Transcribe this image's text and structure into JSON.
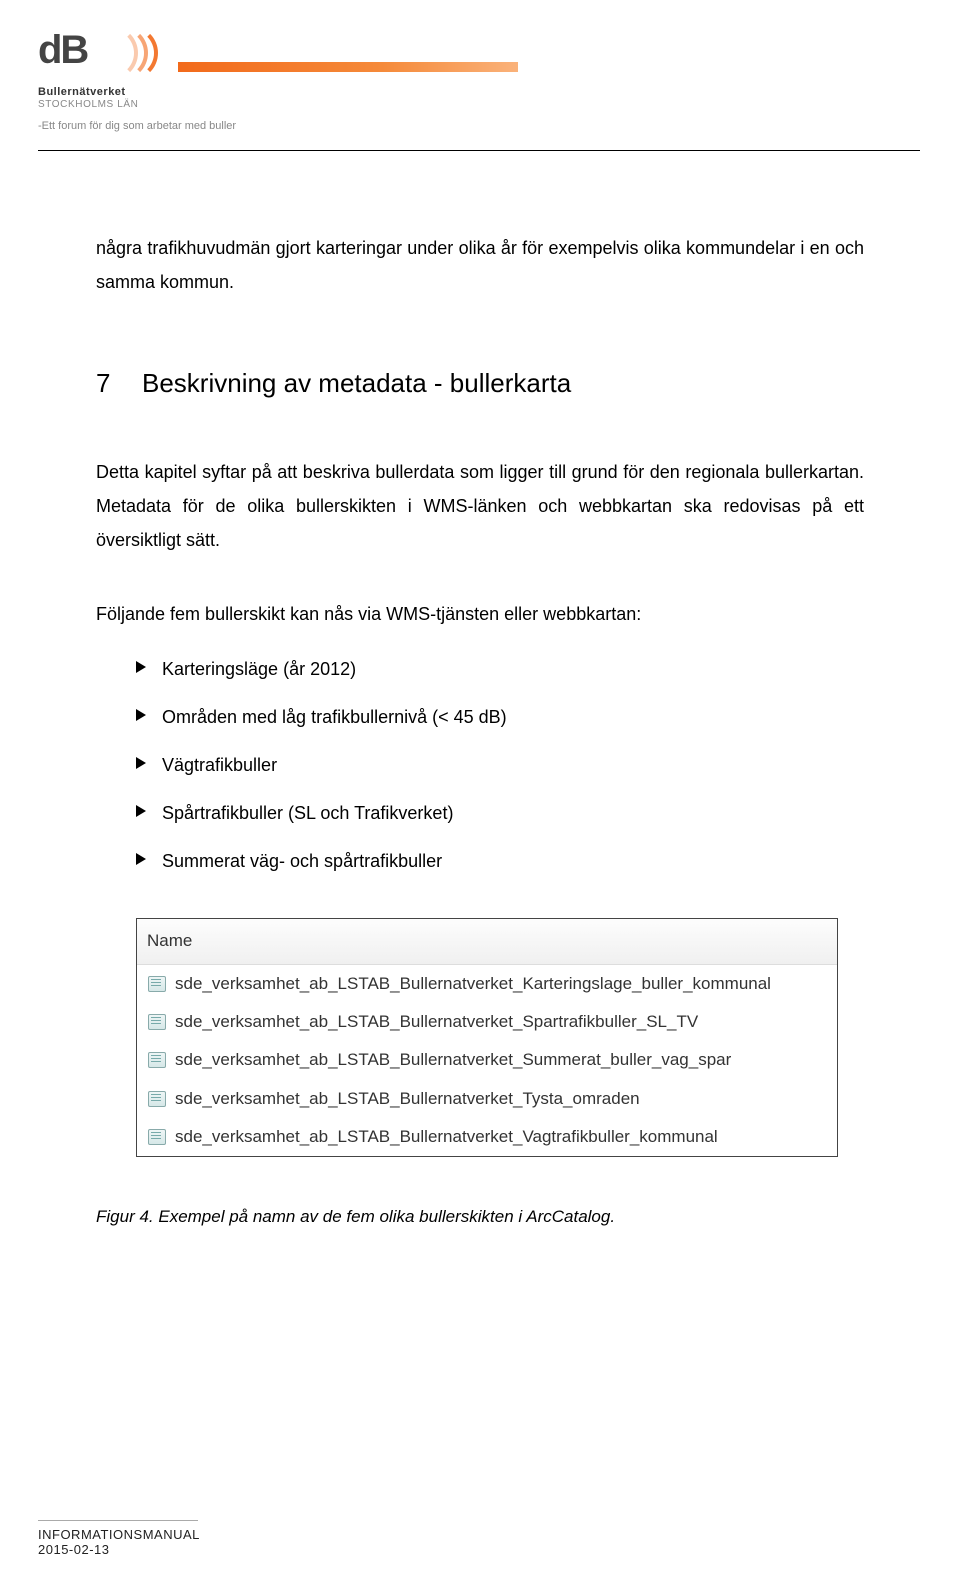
{
  "header": {
    "brand_bold": "Bullernätverket",
    "brand_region": "STOCKHOLMS LÄN",
    "tagline": "-Ett forum för dig som arbetar med buller"
  },
  "body": {
    "para1": "några trafikhuvudmän gjort karteringar under olika år för exempelvis olika kommundelar i en och samma kommun.",
    "h1_num": "7",
    "h1_text": "Beskrivning av metadata - bullerkarta",
    "para2": "Detta kapitel syftar på att beskriva bullerdata som ligger till grund för den regionala bullerkartan. Metadata för de olika bullerskikten i WMS-länken och webbkartan ska redovisas på ett översiktligt sätt.",
    "para3": "Följande fem bullerskikt kan nås via WMS-tjänsten eller webbkartan:",
    "bullets": [
      "Karteringsläge (år 2012)",
      "Områden med låg trafikbullernivå (< 45 dB)",
      "Vägtrafikbuller",
      "Spårtrafikbuller (SL och Trafikverket)",
      "Summerat väg- och spårtrafikbuller"
    ],
    "panel_header": "Name",
    "panel_rows": [
      "sde_verksamhet_ab_LSTAB_Bullernatverket_Karteringslage_buller_kommunal",
      "sde_verksamhet_ab_LSTAB_Bullernatverket_Spartrafikbuller_SL_TV",
      "sde_verksamhet_ab_LSTAB_Bullernatverket_Summerat_buller_vag_spar",
      "sde_verksamhet_ab_LSTAB_Bullernatverket_Tysta_omraden",
      "sde_verksamhet_ab_LSTAB_Bullernatverket_Vagtrafikbuller_kommunal"
    ],
    "caption": "Figur 4. Exempel på namn av de fem olika bullerskikten i ArcCatalog."
  },
  "footer": {
    "line1": "INFORMATIONSMANUAL",
    "line2": "2015-02-13"
  }
}
